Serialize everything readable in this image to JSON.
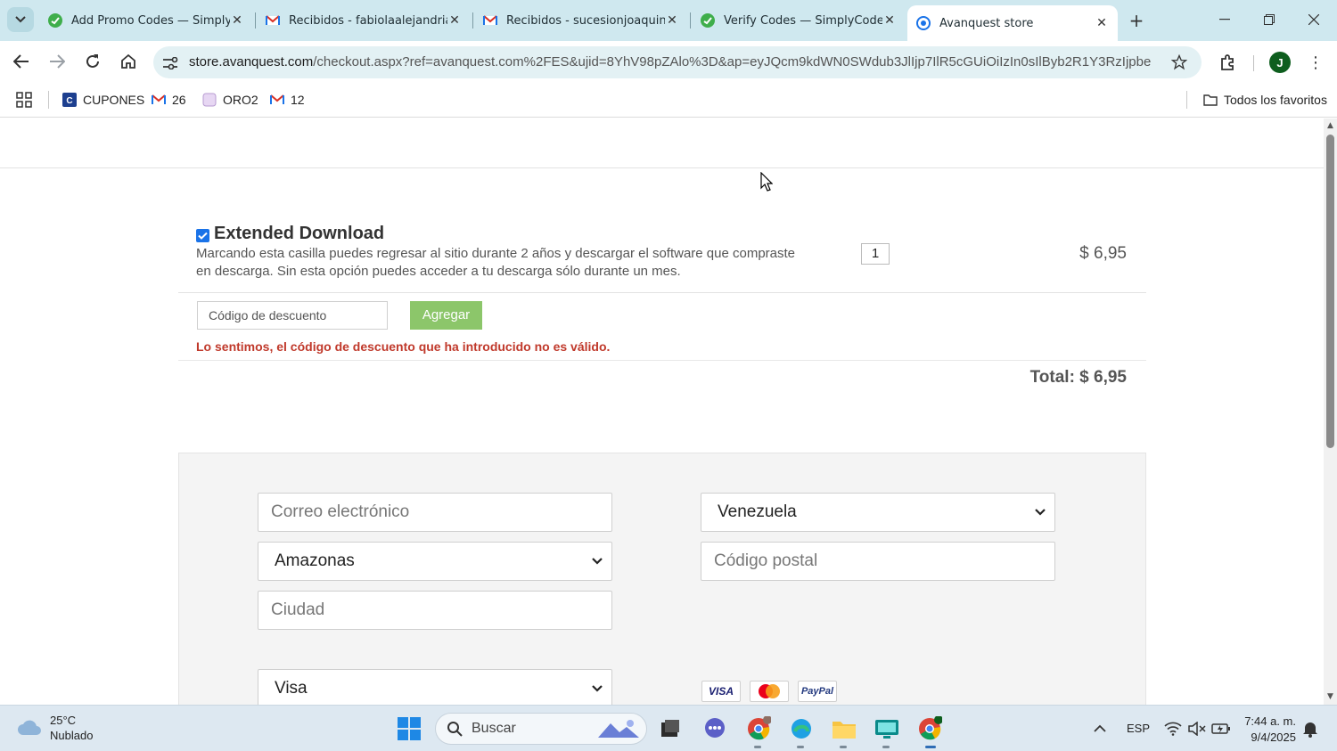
{
  "browser": {
    "tabs": [
      {
        "title": "Add Promo Codes — SimplyCodes",
        "favicon": "simplycodes-icon",
        "active": false
      },
      {
        "title": "Recibidos - fabiolaalejandria",
        "favicon": "gmail-icon",
        "active": false
      },
      {
        "title": "Recibidos - sucesionjoaquin",
        "favicon": "gmail-icon",
        "active": false
      },
      {
        "title": "Verify Codes — SimplyCodes",
        "favicon": "simplycodes-icon",
        "active": false
      },
      {
        "title": "Avanquest store",
        "favicon": "avanquest-icon",
        "active": true
      }
    ],
    "url_host": "store.avanquest.com",
    "url_path": "/checkout.aspx?ref=avanquest.com%2FES&ujid=8YhV98pZAlo%3D&ap=eyJQcm9kdWN0SWdub3JlIjp7IlR5cGUiOiIzIn0sIlByb2R1Y3RzIjpbe",
    "profile_initial": "J",
    "bookmarks": [
      {
        "label": "CUPONES",
        "icon": "cupones-icon"
      },
      {
        "label": "26",
        "icon": "gmail-icon"
      },
      {
        "label": "ORO2",
        "icon": "oro2-icon"
      },
      {
        "label": "12",
        "icon": "gmail-icon"
      }
    ],
    "all_bookmarks_label": "Todos los favoritos"
  },
  "cart": {
    "extended_download": {
      "checked": true,
      "title": "Extended Download",
      "description": "Marcando esta casilla puedes regresar al sitio durante 2 años y descargar el software que compraste en descarga. Sin esta opción puedes acceder a tu descarga sólo durante un mes.",
      "quantity": "1",
      "price": "$ 6,95"
    },
    "coupon": {
      "placeholder": "Código de descuento",
      "button_label": "Agregar",
      "error_message": "Lo sentimos, el código de descuento que ha introducido no es válido."
    },
    "total": "Total: $ 6,95"
  },
  "billing": {
    "email_placeholder": "Correo electrónico",
    "country_selected": "Venezuela",
    "state_selected": "Amazonas",
    "postal_placeholder": "Código postal",
    "city_placeholder": "Ciudad",
    "card_type_selected": "Visa",
    "card_logos": [
      "VISA",
      "mastercard",
      "PayPal"
    ]
  },
  "taskbar": {
    "weather_temp": "25°C",
    "weather_desc": "Nublado",
    "search_placeholder": "Buscar",
    "language": "ESP",
    "time": "7:44 a. m.",
    "date": "9/4/2025"
  },
  "colors": {
    "tabstrip": "#cfe8ef",
    "agregar_button": "#8cc66a",
    "error_text": "#c0392b",
    "checkbox": "#1a73e8"
  }
}
